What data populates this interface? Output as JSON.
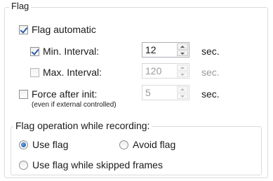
{
  "group": {
    "title": "Flag"
  },
  "flag_automatic": {
    "label": "Flag automatic",
    "checked": true
  },
  "min_interval": {
    "label": "Min. Interval:",
    "checked": true,
    "value": "12",
    "unit": "sec."
  },
  "max_interval": {
    "label": "Max. Interval:",
    "checked": false,
    "value": "120",
    "unit": "sec."
  },
  "force_after_init": {
    "label": "Force after init:",
    "note": "(even if external controlled)",
    "checked": false,
    "value": "5",
    "unit": "sec."
  },
  "recording": {
    "title": "Flag operation while recording:",
    "options": [
      {
        "label": "Use flag",
        "selected": true
      },
      {
        "label": "Avoid flag",
        "selected": false
      },
      {
        "label": "Use flag while skipped frames",
        "selected": false
      }
    ]
  },
  "colors": {
    "check_mark": "#2b5da8",
    "radio_dot": "#1c4f9c",
    "group_border": "#dcdcdc",
    "disabled_text": "#9a9a9a"
  }
}
